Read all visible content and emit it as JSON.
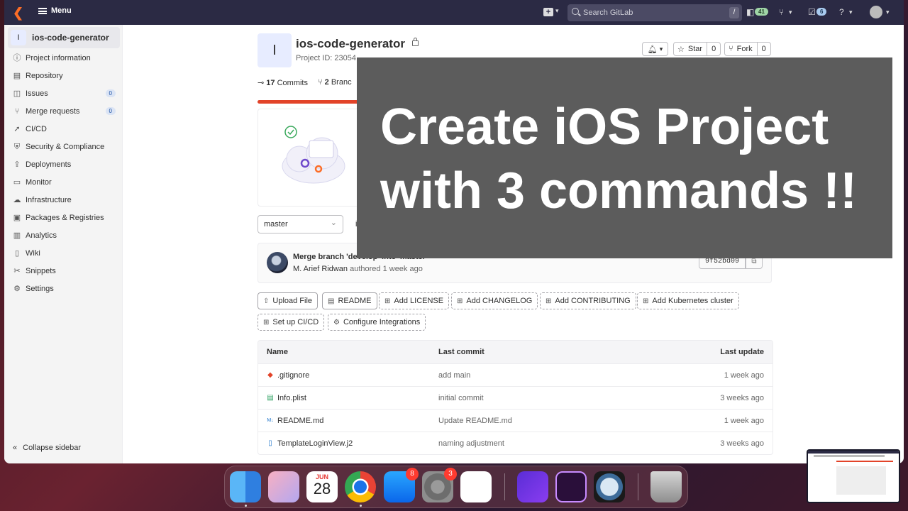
{
  "topbar": {
    "menu_label": "Menu",
    "search_placeholder": "Search GitLab",
    "search_shortcut": "/",
    "issues_count": "41",
    "todos_count": "6"
  },
  "sidebar": {
    "project_initial": "I",
    "project_name": "ios-code-generator",
    "items": [
      {
        "label": "Project information",
        "icon": "info-icon"
      },
      {
        "label": "Repository",
        "icon": "book-icon"
      },
      {
        "label": "Issues",
        "icon": "issues-icon",
        "count": "0"
      },
      {
        "label": "Merge requests",
        "icon": "merge-request-icon",
        "count": "0"
      },
      {
        "label": "CI/CD",
        "icon": "rocket-icon"
      },
      {
        "label": "Security & Compliance",
        "icon": "shield-icon"
      },
      {
        "label": "Deployments",
        "icon": "deployments-icon"
      },
      {
        "label": "Monitor",
        "icon": "monitor-icon"
      },
      {
        "label": "Infrastructure",
        "icon": "cloud-icon"
      },
      {
        "label": "Packages & Registries",
        "icon": "package-icon"
      },
      {
        "label": "Analytics",
        "icon": "chart-icon"
      },
      {
        "label": "Wiki",
        "icon": "wiki-icon"
      },
      {
        "label": "Snippets",
        "icon": "snippet-icon"
      },
      {
        "label": "Settings",
        "icon": "gear-icon"
      }
    ],
    "collapse_label": "Collapse sidebar"
  },
  "project": {
    "initial": "I",
    "title": "ios-code-generator",
    "id_label": "Project ID: 23054",
    "star_label": "Star",
    "star_count": "0",
    "fork_label": "Fork",
    "fork_count": "0",
    "commits_count": "17",
    "commits_label": "Commits",
    "branches_count": "2",
    "branches_label": "Branc",
    "progress_fraction": 0.2,
    "branch": "master",
    "branch_path_fragment": "i"
  },
  "last_commit": {
    "title": "Merge branch 'develop' into 'master'",
    "author": "M. Arief Ridwan",
    "authored_text": "authored 1 week ago",
    "sha": "9f52bd09"
  },
  "quick_actions": [
    {
      "label": "Upload File",
      "icon": "upload-icon"
    },
    {
      "label": "README",
      "icon": "document-icon"
    },
    {
      "label": "Add LICENSE",
      "icon": "plus-square-icon"
    },
    {
      "label": "Add CHANGELOG",
      "icon": "plus-square-icon"
    },
    {
      "label": "Add CONTRIBUTING",
      "icon": "plus-square-icon"
    },
    {
      "label": "Add Kubernetes cluster",
      "icon": "plus-square-icon"
    },
    {
      "label": "Set up CI/CD",
      "icon": "plus-square-icon"
    },
    {
      "label": "Configure Integrations",
      "icon": "settings-icon"
    }
  ],
  "files": {
    "headers": [
      "Name",
      "Last commit",
      "Last update"
    ],
    "rows": [
      {
        "name": ".gitignore",
        "commit": "add main",
        "updated": "1 week ago",
        "icon": "git-icon"
      },
      {
        "name": "Info.plist",
        "commit": "initial commit",
        "updated": "3 weeks ago",
        "icon": "file-green-icon"
      },
      {
        "name": "README.md",
        "commit": "Update README.md",
        "updated": "1 week ago",
        "icon": "markdown-icon"
      },
      {
        "name": "TemplateLoginView.j2",
        "commit": "naming adjustment",
        "updated": "3 weeks ago",
        "icon": "file-icon"
      }
    ]
  },
  "overlay": {
    "line1": "Create iOS Project",
    "line2": "with 3 commands !!"
  },
  "dock": {
    "calendar_month": "JUN",
    "calendar_day": "28",
    "appstore_badge": "8",
    "settings_badge": "3"
  },
  "colors": {
    "nav_bg": "#2b2a44",
    "accent_orange": "#fc6d26",
    "overlay_bg": "#5c5c5c"
  }
}
